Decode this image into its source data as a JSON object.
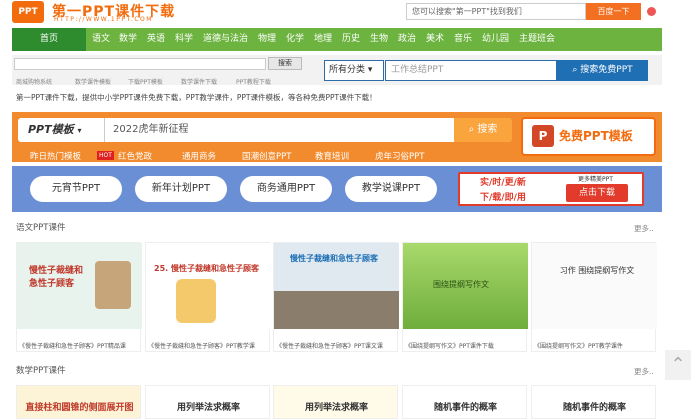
{
  "header": {
    "logo_text": "PPT",
    "site_name": "第一PPT课件下载",
    "site_url": "HTTP://WWW.1PPT.COM",
    "search_placeholder": "您可以搜索\"第一PPT\"找到我们",
    "search_button": "百度一下"
  },
  "nav": {
    "home": "首页",
    "items": [
      "语文",
      "数学",
      "英语",
      "科学",
      "道德与法治",
      "物理",
      "化学",
      "地理",
      "历史",
      "生物",
      "政治",
      "美术",
      "音乐",
      "幼儿园",
      "主题班会"
    ]
  },
  "mini_search": {
    "button": "搜索",
    "links": [
      "商城购物系统",
      "数学课件模板",
      "下载PPT模板",
      "数学课件下载",
      "PPT教程下载"
    ]
  },
  "main_search": {
    "category": "所有分类",
    "placeholder": "工作总结PPT",
    "button": "搜索免费PPT"
  },
  "description": "第一PPT课件下载，提供中小学PPT课件免费下载，PPT教学课件，PPT课件模板，等各种免费PPT课件下载！",
  "orange_search": {
    "select": "PPT模板",
    "input_value": "2022虎年新征程",
    "button": "搜索",
    "free_button": "免费PPT模板",
    "ppt_logo": "P"
  },
  "hot": {
    "label": "昨日热门模板",
    "badge": "HOT",
    "items": [
      "红色党政",
      "通用商务",
      "国潮创意PPT",
      "教育培训",
      "虎年习俗PPT"
    ]
  },
  "tags": [
    "元宵节PPT",
    "新年计划PPT",
    "商务通用PPT",
    "教学说课PPT"
  ],
  "promo": {
    "line1": "实/时/更/新",
    "line2": "下/载/即/用",
    "small": "更多精美PPT",
    "button": "点击下载"
  },
  "sections": [
    {
      "title": "语文PPT课件",
      "more": "更多..",
      "cards": [
        {
          "thumb_text": "慢性子裁缝和急性子顾客",
          "caption": "《慢性子裁缝和急性子顾客》PPT精品课"
        },
        {
          "thumb_text": "25. 慢性子裁缝和急性子顾客",
          "caption": "《慢性子裁缝和急性子顾客》PPT教学课"
        },
        {
          "thumb_text": "慢性子裁缝和急性子顾客",
          "caption": "《慢性子裁缝和急性子顾客》PPT课文课"
        },
        {
          "thumb_text": "围绕提纲写作文",
          "caption": "《围绕提纲写作文》PPT课件下载"
        },
        {
          "thumb_text": "习作 围绕提纲写作文",
          "caption": "《围绕提纲写作文》PPT教学课件"
        }
      ]
    },
    {
      "title": "数学PPT课件",
      "more": "更多..",
      "cards": [
        {
          "thumb_text": "直接柱和圆锥的侧面展开图"
        },
        {
          "thumb_text": "用列举法求概率"
        },
        {
          "thumb_text": "用列举法求概率"
        },
        {
          "thumb_text": "随机事件的概率"
        },
        {
          "thumb_text": "随机事件的概率"
        }
      ]
    }
  ],
  "colors": {
    "nav_green": "#6db33f",
    "orange": "#f28b2e",
    "blue_tags": "#6a8fd4",
    "red": "#e23b2b"
  }
}
